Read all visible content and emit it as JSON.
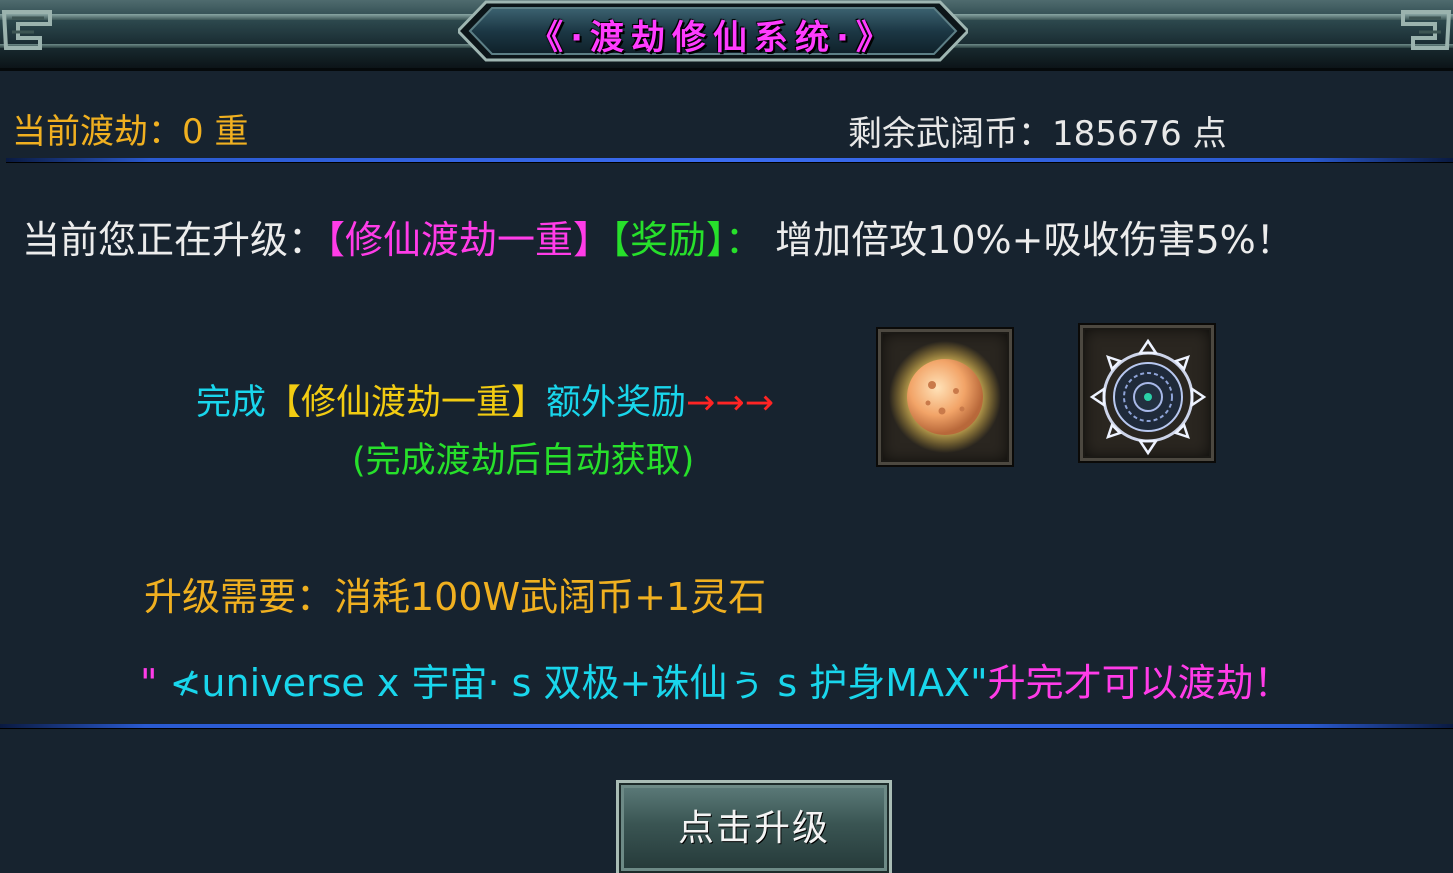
{
  "header": {
    "title": "《·渡劫修仙系统·》"
  },
  "status": {
    "current_level_label": "当前渡劫：",
    "current_level_value": "0",
    "current_level_unit": "重",
    "coins_label": "剩余武阔币：",
    "coins_value": "185676",
    "coins_unit": "点"
  },
  "upgrade": {
    "prefix": "当前您正在升级：",
    "stage": "【修仙渡劫一重】",
    "reward_tag": "【奖励】",
    "colon": "：",
    "reward_text": "增加倍攻10%+吸收伤害5%！"
  },
  "extra_reward": {
    "prefix": "完成",
    "stage": "【修仙渡劫一重】",
    "suffix": "额外奖励",
    "arrows": "→→→",
    "note": "(完成渡劫后自动获取)",
    "items": [
      {
        "icon": "golden-orb-icon"
      },
      {
        "icon": "frost-sigil-icon"
      }
    ]
  },
  "requirement": {
    "text": "升级需要：消耗100W武阔币+1灵石"
  },
  "condition": {
    "quote_open": "\"",
    "item_name": " ≮universe x 宇宙· s 双极+诛仙ぅ s 护身MAX",
    "quote_close": "\"",
    "suffix": "升完才可以渡劫！"
  },
  "action": {
    "button_label": "点击升级"
  },
  "colors": {
    "gold": "#f0b020",
    "magenta": "#ff3ce8",
    "green": "#27e02b",
    "cyan": "#19d6ec",
    "red": "#ff2424",
    "background": "#17232f"
  }
}
